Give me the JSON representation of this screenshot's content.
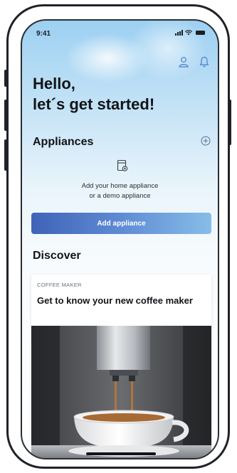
{
  "status_bar": {
    "time": "9:41"
  },
  "header": {
    "greeting_line1": "Hello,",
    "greeting_line2": "let´s get started!"
  },
  "appliances": {
    "title": "Appliances",
    "empty_line1": "Add your home appliance",
    "empty_line2": "or a demo appliance",
    "add_button_label": "Add appliance"
  },
  "discover": {
    "title": "Discover",
    "card": {
      "category": "COFFEE MAKER",
      "title": "Get to know your new coffee maker"
    }
  },
  "icons": {
    "profile": "person-icon",
    "notifications": "bell-icon",
    "add": "plus-circle-icon",
    "appliance": "appliance-add-icon"
  },
  "colors": {
    "accent_start": "#3f63b8",
    "accent_end": "#87bde8",
    "text": "#111418"
  }
}
